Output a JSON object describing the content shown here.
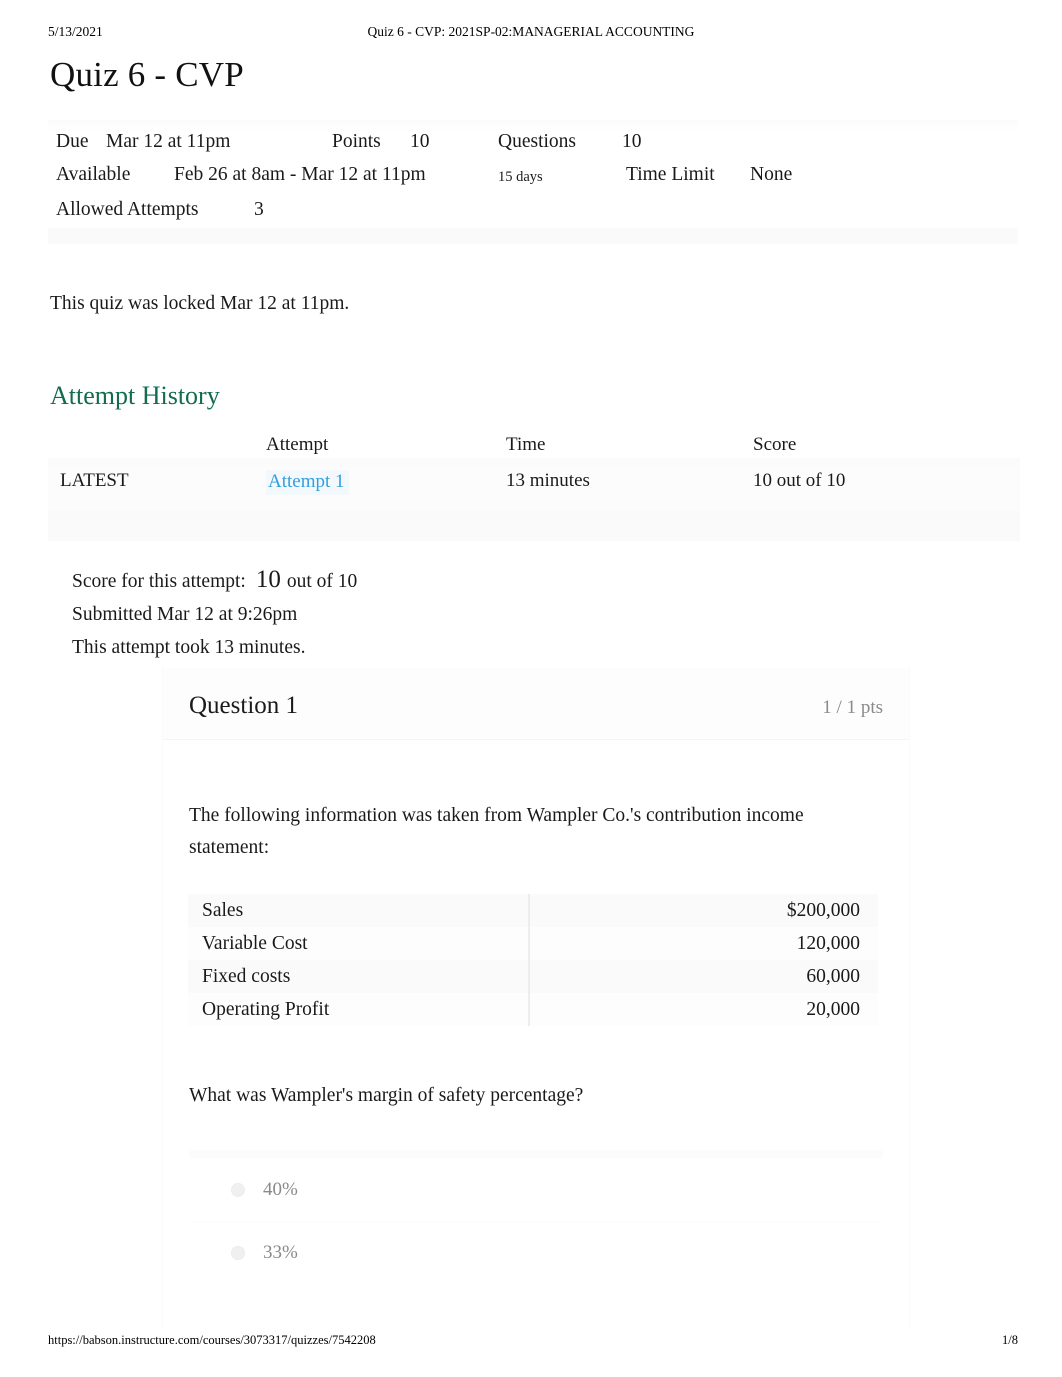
{
  "print_header": {
    "date": "5/13/2021",
    "title": "Quiz 6 - CVP: 2021SP-02:MANAGERIAL ACCOUNTING"
  },
  "page": {
    "title": "Quiz 6 - CVP"
  },
  "quiz_meta": {
    "due_label": "Due",
    "due_value": "Mar 12 at 11pm",
    "points_label": "Points",
    "points_value": "10",
    "questions_label": "Questions",
    "questions_value": "10",
    "available_label": "Available",
    "available_value": "Feb 26 at 8am - Mar 12 at 11pm",
    "available_duration": "15 days",
    "time_limit_label": "Time Limit",
    "time_limit_value": "None",
    "allowed_attempts_label": "Allowed Attempts",
    "allowed_attempts_value": "3"
  },
  "locked_note": "This quiz was locked Mar 12 at 11pm.",
  "attempt_history": {
    "heading": "Attempt History",
    "columns": {
      "blank": "",
      "attempt": "Attempt",
      "time": "Time",
      "score": "Score"
    },
    "rows": [
      {
        "badge": "LATEST",
        "attempt": "Attempt 1",
        "time": "13 minutes",
        "score": "10 out of 10"
      }
    ]
  },
  "score_summary": {
    "score_label": "Score for this attempt:",
    "score_value": "10",
    "score_out_of": "out of 10",
    "submitted": "Submitted Mar 12 at 9:26pm",
    "duration": "This attempt took 13 minutes."
  },
  "question": {
    "title": "Question 1",
    "points": "1 / 1 pts",
    "intro": "The following information was taken from Wampler Co.'s contribution income statement:",
    "data_table": [
      {
        "label": "Sales",
        "value": "$200,000"
      },
      {
        "label": "Variable Cost",
        "value": "120,000"
      },
      {
        "label": "Fixed costs",
        "value": "60,000"
      },
      {
        "label": "Operating Profit",
        "value": "20,000"
      }
    ],
    "prompt": "What was Wampler's margin of safety percentage?",
    "answers": [
      {
        "text": "40%"
      },
      {
        "text": "33%"
      }
    ]
  },
  "print_footer": {
    "url": "https://babson.instructure.com/courses/3073317/quizzes/7542208",
    "page_number": "1/8"
  },
  "colors": {
    "link": "#2f9fe0",
    "heading_green": "#136c50",
    "muted": "#8a8a8a"
  }
}
